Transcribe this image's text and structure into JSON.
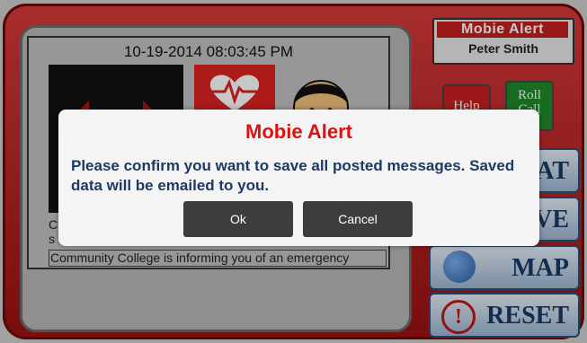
{
  "header": {
    "app_title": "Mobie Alert",
    "user_name": "Peter Smith"
  },
  "panel": {
    "datetime": "10-19-2014 08:03:45 PM",
    "message_line1": "C",
    "message_line2": "s",
    "message_line3": "Community College is informing you of an emergency"
  },
  "buttons": {
    "help": "Help",
    "roll_call": "Roll Call",
    "chat": "AT",
    "save": "VE",
    "map": "MAP",
    "reset": "RESET"
  },
  "dialog": {
    "title": "Mobie Alert",
    "message": "Please confirm you want to save all posted messages. Saved data will be emailed to you.",
    "ok_label": "Ok",
    "cancel_label": "Cancel"
  },
  "colors": {
    "frame_red": "#c42020",
    "dialog_title_red": "#e01010",
    "dialog_text_blue": "#1d3a66",
    "dialog_button": "#3d3d3d"
  },
  "icons": {
    "arrows": "double-arrow-icon",
    "heart": "heartbeat-icon",
    "face": "person-face-icon",
    "map": "globe-icon",
    "reset": "alert-icon"
  }
}
